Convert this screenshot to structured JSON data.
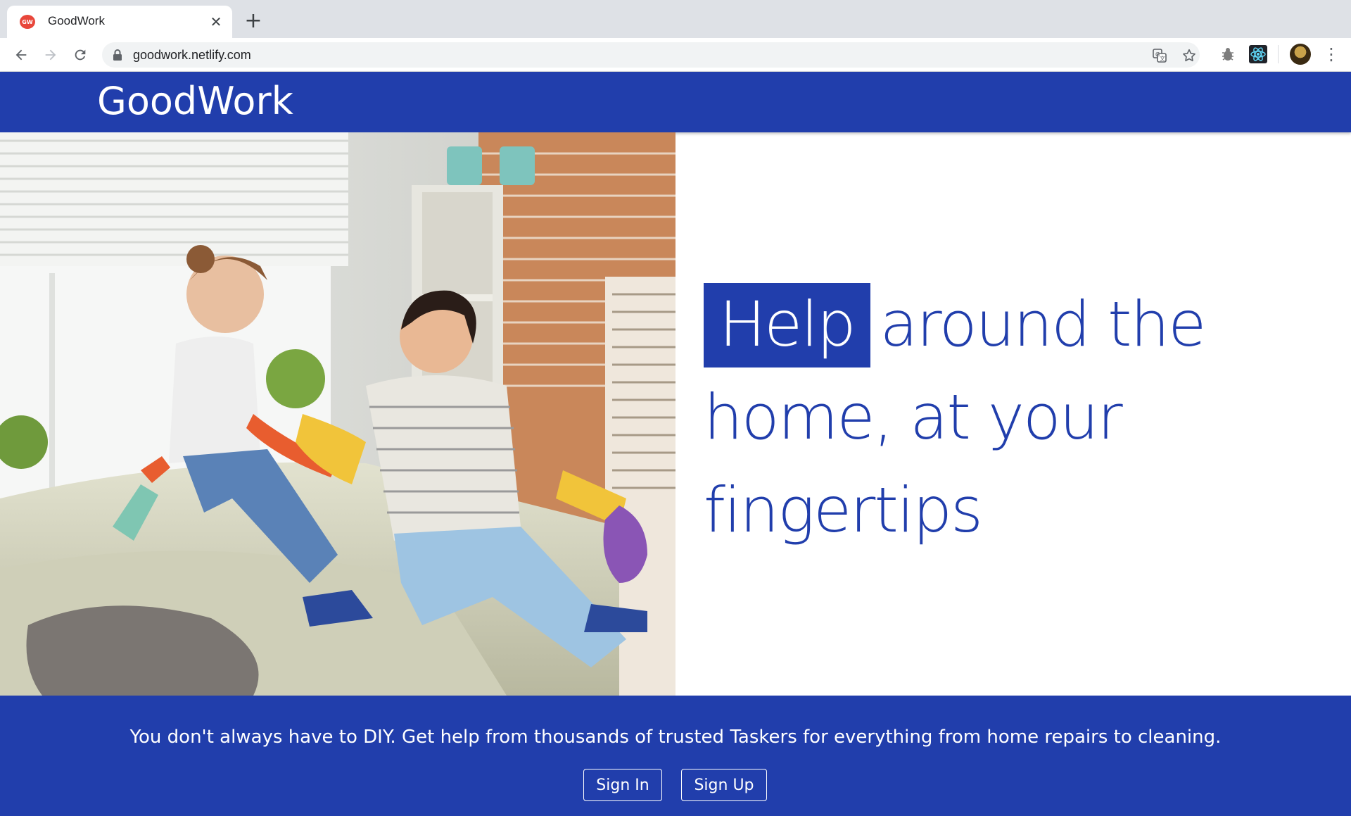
{
  "browser": {
    "tab_title": "GoodWork",
    "favicon_text": "GW",
    "url": "goodwork.netlify.com",
    "icons": [
      "back-icon",
      "forward-icon",
      "reload-icon",
      "lock-icon",
      "translate-icon",
      "star-icon",
      "bug-extension-icon",
      "react-extension-icon",
      "menu-icon"
    ]
  },
  "header": {
    "brand": "GoodWork"
  },
  "hero": {
    "highlight_word": "Help",
    "headline_rest": "around the home, at your fingertips",
    "image_subject": "woman and girl cleaning a sofa in a living room"
  },
  "footer": {
    "tagline": "You don't always have to DIY. Get help from thousands of trusted Taskers for everything from home repairs to cleaning.",
    "sign_in_label": "Sign In",
    "sign_up_label": "Sign Up"
  },
  "colors": {
    "brand_blue": "#213eac",
    "white": "#ffffff"
  }
}
